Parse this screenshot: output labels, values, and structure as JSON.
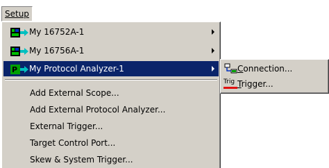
{
  "menubar": {
    "setup_label": "Setup"
  },
  "menu": {
    "items": [
      {
        "label": "My 16752A-1",
        "icon": "logic-analyzer-module-icon",
        "has_submenu": true
      },
      {
        "label": "My 16756A-1",
        "icon": "logic-analyzer-module-icon",
        "has_submenu": true
      },
      {
        "label": "My Protocol Analyzer-1",
        "icon": "protocol-analyzer-module-icon",
        "has_submenu": true,
        "highlighted": true
      }
    ],
    "plain_items": [
      {
        "label": "Add External Scope..."
      },
      {
        "label": "Add External Protocol Analyzer..."
      },
      {
        "label": "External Trigger..."
      },
      {
        "label": "Target Control Port..."
      },
      {
        "label": "Skew & System Trigger..."
      }
    ]
  },
  "submenu": {
    "items": [
      {
        "label": "Connection...",
        "icon": "connection-icon"
      },
      {
        "label": "Trigger...",
        "icon": "trigger-icon",
        "icon_text": "Trig"
      }
    ]
  },
  "colors": {
    "menu_bg": "#d4d0c8",
    "highlight_bg": "#0a246a",
    "highlight_fg": "#ffffff",
    "module_icon_green": "#00c000",
    "module_icon_blue": "#0030c0",
    "protocol_icon_green": "#00a000",
    "trigger_red": "#e01010"
  }
}
